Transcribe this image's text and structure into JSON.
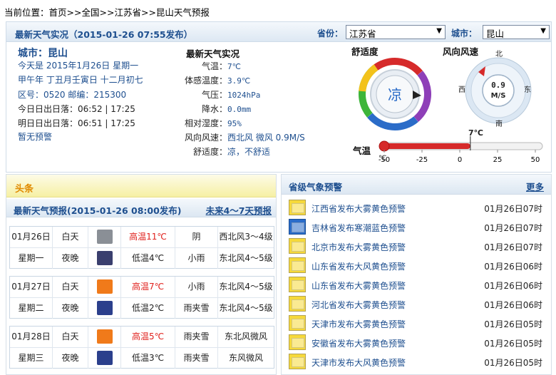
{
  "breadcrumb": {
    "prefix": "当前位置：",
    "items": [
      "首页",
      "全国",
      "江苏省",
      "昆山天气预报"
    ],
    "sep": ">>"
  },
  "top": {
    "title": "最新天气实况（2015-01-26 07:55发布）",
    "province_label": "省份：",
    "province_value": "江苏省",
    "city_label": "城市：",
    "city_value": "昆山"
  },
  "city": {
    "title": "城市：昆山",
    "today": "今天是 2015年1月26日 星期一",
    "lunar": "甲午年 丁丑月壬寅日 十二月初七",
    "codes": "区号：0520   邮编：215300",
    "sun_today": "今日日出日落：06:52 | 17:25",
    "sun_tomorrow": "明日日出日落：06:51 | 17:25",
    "no_warning": "暂无预警"
  },
  "observation": {
    "title": "最新天气实况",
    "rows": [
      {
        "k": "气温：",
        "v": "7℃"
      },
      {
        "k": "体感温度：",
        "v": "3.9℃"
      },
      {
        "k": "气压：",
        "v": "1024hPa"
      },
      {
        "k": "降水：",
        "v": "0.0mm"
      },
      {
        "k": "相对湿度：",
        "v": "95%"
      },
      {
        "k": "风向风速：",
        "v": "西北风 微风 0.9M/S"
      },
      {
        "k": "舒适度：",
        "v": "凉，不舒适"
      }
    ]
  },
  "gauges": {
    "comfort_label": "舒适度",
    "comfort_value": "凉",
    "wind_label": "风向风速",
    "wind_value": "0.9",
    "wind_unit": "M/S",
    "dir_n": "北",
    "dir_s": "南",
    "dir_e": "东",
    "dir_w": "西",
    "temp_label": "气温",
    "temp_unit": "℃",
    "temp_current": "7℃",
    "temp_value": 7,
    "temp_ticks": [
      "-50",
      "-25",
      "0",
      "25",
      "50"
    ],
    "colors": {
      "ring_red": "#d62a2a",
      "ring_yellow": "#f3c21b",
      "ring_green": "#3db53a",
      "ring_blue": "#2b6cc8",
      "ring_purple": "#8e3fb8"
    }
  },
  "headline": {
    "label": "头条"
  },
  "forecast": {
    "title": "最新天气预报(2015-01-26 08:00发布)",
    "more": "未来4～7天预报",
    "days": [
      {
        "date": "01月26日",
        "weekday": "星期一",
        "day": {
          "part": "白天",
          "icon": "cloudy-icon",
          "temp": "高温11℃",
          "wx": "阴",
          "wind": "西北风3～4级"
        },
        "night": {
          "part": "夜晚",
          "icon": "light-rain-icon",
          "temp": "低温4℃",
          "wx": "小雨",
          "wind": "东北风4～5级"
        }
      },
      {
        "date": "01月27日",
        "weekday": "星期二",
        "day": {
          "part": "白天",
          "icon": "light-rain-icon",
          "temp": "高温7℃",
          "wx": "小雨",
          "wind": "东北风4～5级"
        },
        "night": {
          "part": "夜晚",
          "icon": "sleet-icon",
          "temp": "低温2℃",
          "wx": "雨夹雪",
          "wind": "东北风4～5级"
        }
      },
      {
        "date": "01月28日",
        "weekday": "星期三",
        "day": {
          "part": "白天",
          "icon": "sleet-icon",
          "temp": "高温5℃",
          "wx": "雨夹雪",
          "wind": "东北风微风"
        },
        "night": {
          "part": "夜晚",
          "icon": "sleet-icon",
          "temp": "低温3℃",
          "wx": "雨夹雪",
          "wind": "东风微风"
        }
      }
    ]
  },
  "warnings": {
    "title": "省级气象预警",
    "more": "更多",
    "items": [
      {
        "name": "江西省发布大雾黄色预警",
        "time": "01月26日07时",
        "color": "yellow"
      },
      {
        "name": "吉林省发布寒潮蓝色预警",
        "time": "01月26日07时",
        "color": "blue"
      },
      {
        "name": "北京市发布大雾黄色预警",
        "time": "01月26日07时",
        "color": "yellow"
      },
      {
        "name": "山东省发布大风黄色预警",
        "time": "01月26日06时",
        "color": "yellow"
      },
      {
        "name": "山东省发布大雾黄色预警",
        "time": "01月26日06时",
        "color": "yellow"
      },
      {
        "name": "河北省发布大雾黄色预警",
        "time": "01月26日06时",
        "color": "yellow"
      },
      {
        "name": "天津市发布大雾黄色预警",
        "time": "01月26日05时",
        "color": "yellow"
      },
      {
        "name": "安徽省发布大雾黄色预警",
        "time": "01月26日05时",
        "color": "yellow"
      },
      {
        "name": "天津市发布大风黄色预警",
        "time": "01月26日05时",
        "color": "yellow"
      }
    ]
  }
}
